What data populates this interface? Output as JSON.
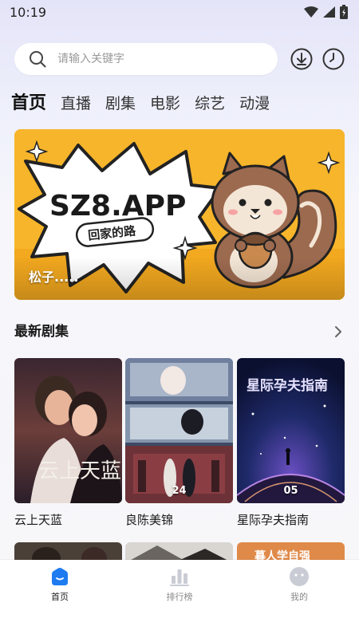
{
  "status_bar": {
    "time": "10:19",
    "icons": [
      "wifi-icon",
      "signal-icon",
      "battery-icon"
    ]
  },
  "search": {
    "placeholder": "请输入关键字",
    "value": ""
  },
  "header_actions": [
    "download-icon",
    "history-icon"
  ],
  "tabs": [
    {
      "label": "首页",
      "active": true
    },
    {
      "label": "直播",
      "active": false
    },
    {
      "label": "剧集",
      "active": false
    },
    {
      "label": "电影",
      "active": false
    },
    {
      "label": "综艺",
      "active": false
    },
    {
      "label": "动漫",
      "active": false
    }
  ],
  "banner": {
    "logo_text": "SZ8.APP",
    "sub_text": "回家的路",
    "caption": "松子.....",
    "background_color": "#f6b62a"
  },
  "section": {
    "title": "最新剧集",
    "more_icon": "chevron-right-icon"
  },
  "cards": [
    {
      "title": "云上天蓝",
      "poster_text": "云上天蓝",
      "episode": ""
    },
    {
      "title": "良陈美锦",
      "poster_text": "",
      "episode": "24"
    },
    {
      "title": "星际孕夫指南",
      "poster_text": "星际孕夫指南",
      "episode": "05"
    }
  ],
  "row2_texts": [
    "",
    "",
    "暮人学自强"
  ],
  "bottom_nav": [
    {
      "label": "首页",
      "icon": "home-icon",
      "active": true
    },
    {
      "label": "排行榜",
      "icon": "ranking-icon",
      "active": false
    },
    {
      "label": "我的",
      "icon": "profile-icon",
      "active": false
    }
  ],
  "colors": {
    "accent": "#1e7bf0",
    "inactive_icon": "#c9ccd4"
  }
}
